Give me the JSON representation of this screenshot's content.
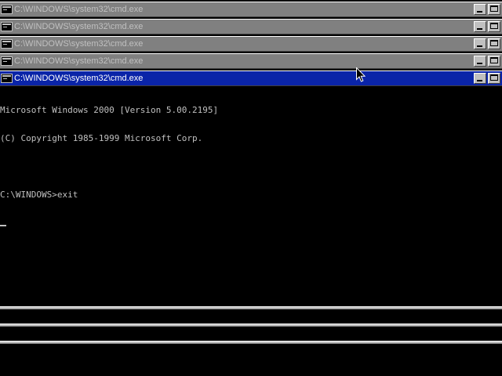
{
  "windows": [
    {
      "title": "C:\\WINDOWS\\system32\\cmd.exe",
      "active": false
    },
    {
      "title": "C:\\WINDOWS\\system32\\cmd.exe",
      "active": false
    },
    {
      "title": "C:\\WINDOWS\\system32\\cmd.exe",
      "active": false
    },
    {
      "title": "C:\\WINDOWS\\system32\\cmd.exe",
      "active": false
    },
    {
      "title": "C:\\WINDOWS\\system32\\cmd.exe",
      "active": true
    }
  ],
  "console": {
    "lines": [
      "Microsoft Windows 2000 [Version 5.00.2195]",
      "(C) Copyright 1985-1999 Microsoft Corp.",
      "",
      "C:\\WINDOWS>exit"
    ]
  },
  "icons": {
    "app": "cmd-console-icon",
    "minimize": "minimize-icon",
    "maximize": "maximize-icon",
    "pointer": "mouse-pointer-icon"
  },
  "colors": {
    "active_title": "#0a24a8",
    "inactive_title": "#808080",
    "inactive_text": "#c0c0c0",
    "console_bg": "#000000",
    "console_text": "#c0c0c0"
  }
}
